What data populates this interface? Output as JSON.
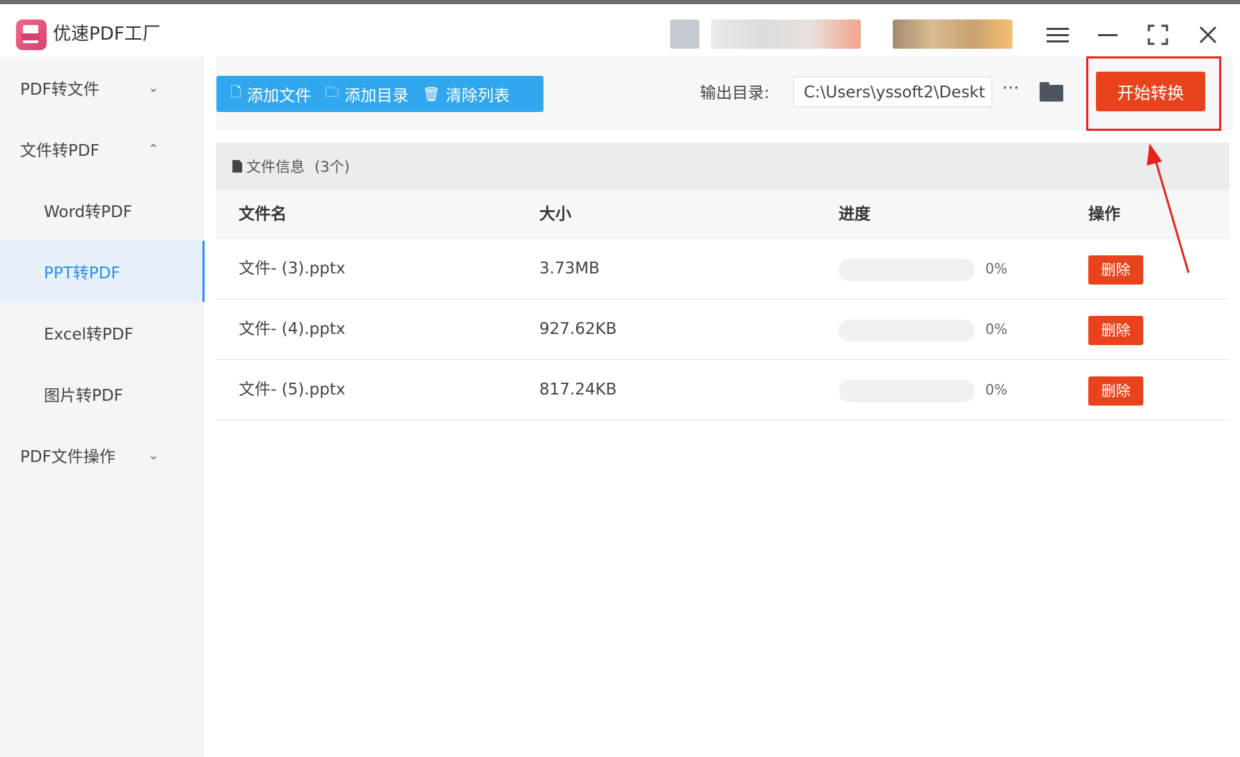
{
  "app": {
    "title": "优速PDF工厂"
  },
  "sidebar": {
    "groups": [
      {
        "label": "PDF转文件",
        "chevron": "⌄"
      },
      {
        "label": "文件转PDF",
        "chevron": "⌃"
      },
      {
        "label": "PDF文件操作",
        "chevron": "⌄"
      }
    ],
    "subitems": [
      {
        "label": "Word转PDF"
      },
      {
        "label": "PPT转PDF",
        "active": true
      },
      {
        "label": "Excel转PDF"
      },
      {
        "label": "图片转PDF"
      }
    ]
  },
  "toolbar": {
    "add_file": "添加文件",
    "add_dir": "添加目录",
    "clear_list": "清除列表",
    "output_label": "输出目录:",
    "output_path": "C:\\Users\\yssoft2\\Deskt",
    "more": "···",
    "start": "开始转换"
  },
  "file_info": {
    "label": "文件信息",
    "count": "(3个)"
  },
  "table": {
    "headers": {
      "name": "文件名",
      "size": "大小",
      "progress": "进度",
      "action": "操作"
    },
    "rows": [
      {
        "name": "文件- (3).pptx",
        "size": "3.73MB",
        "progress": "0%",
        "progress_value": 0,
        "action": "删除"
      },
      {
        "name": "文件- (4).pptx",
        "size": "927.62KB",
        "progress": "0%",
        "progress_value": 0,
        "action": "删除"
      },
      {
        "name": "文件- (5).pptx",
        "size": "817.24KB",
        "progress": "0%",
        "progress_value": 0,
        "action": "删除"
      }
    ]
  },
  "colors": {
    "accent_blue": "#31a7ef",
    "danger_red": "#e8431c",
    "highlight_red": "#e8231c"
  },
  "icons": {
    "app_logo": "pdf-logo-icon",
    "menu": "menu-icon",
    "minimize": "minimize-icon",
    "maximize": "maximize-icon",
    "close": "close-icon"
  }
}
